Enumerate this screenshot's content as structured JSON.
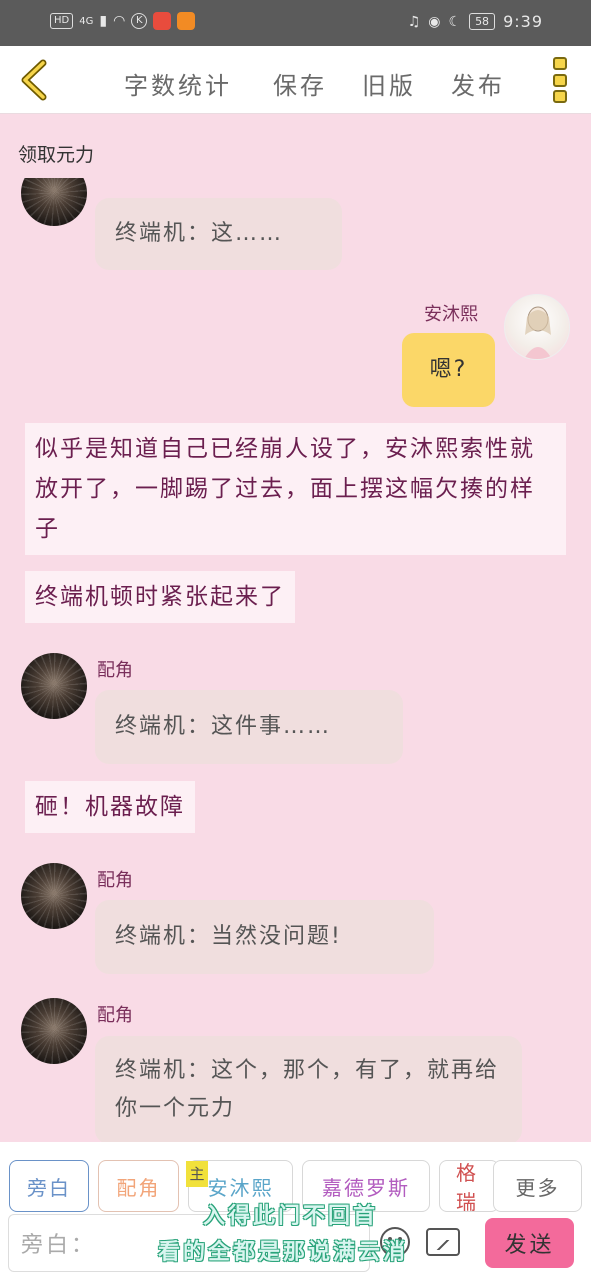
{
  "status_bar": {
    "hd": "HD",
    "network": "4G",
    "battery": "58",
    "time": "9:39"
  },
  "toolbar": {
    "word_count": "字数统计",
    "save": "保存",
    "old_version": "旧版",
    "publish": "发布"
  },
  "banner": "领取元力",
  "messages": {
    "m1": "终端机：这……",
    "m2_name": "安沐熙",
    "m2": "嗯?",
    "n1": "似乎是知道自己已经崩人设了，安沐熙索性就放开了，一脚踢了过去，面上摆这幅欠揍的样子",
    "n2": "终端机顿时紧张起来了",
    "m3_name": "配角",
    "m3": "终端机：这件事……",
    "n3": "砸！机器故障",
    "m4_name": "配角",
    "m4": "终端机：当然没问题!",
    "m5_name": "配角",
    "m5": "终端机：这个，那个，有了，就再给你一个元力"
  },
  "roles": {
    "narrator": "旁白",
    "supporting": "配角",
    "main_tag": "主",
    "anmuxi": "安沐熙",
    "jiade": "嘉德罗斯",
    "gerui": "格瑞",
    "more": "更多"
  },
  "input": {
    "placeholder": "旁白："
  },
  "send_label": "发送",
  "watermark": {
    "line1": "入得此门不回首",
    "line2": "看的全都是那说满云消"
  },
  "colors": {
    "background": "#f9dbe6",
    "accent": "#f36a9b",
    "self_bubble": "#fbd768",
    "narration_text": "#6b1f4f"
  }
}
